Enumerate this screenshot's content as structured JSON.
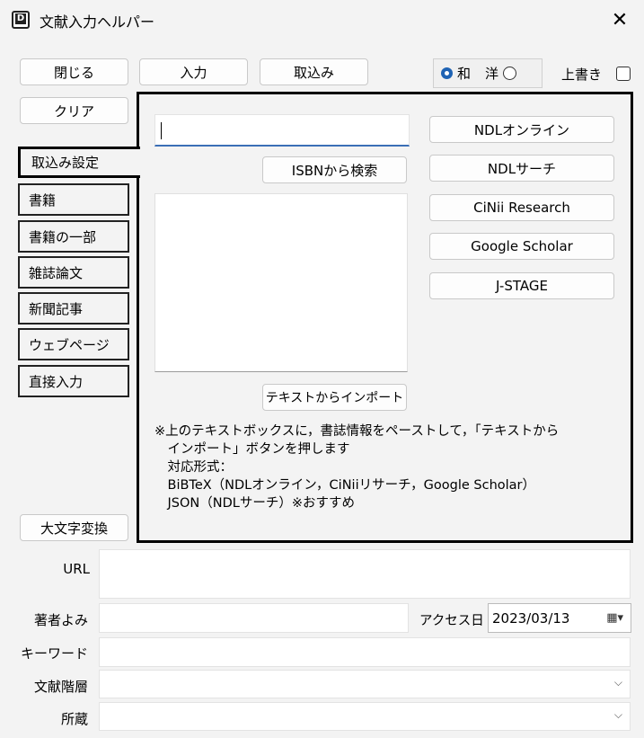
{
  "window": {
    "title": "文献入力ヘルパー",
    "app_icon_letter": "D",
    "close_glyph": "✕"
  },
  "top_buttons": {
    "close": "閉じる",
    "input": "入力",
    "import": "取込み",
    "clear": "クリア"
  },
  "language_radio": {
    "option_ja": "和",
    "option_en": "洋",
    "selected": "和"
  },
  "overwrite": {
    "label": "上書き",
    "checked": false
  },
  "tabs": {
    "active": "取込み設定",
    "items": [
      "書籍",
      "書籍の一部",
      "雑誌論文",
      "新聞記事",
      "ウェブページ",
      "直接入力"
    ]
  },
  "import_panel": {
    "isbn_value": "",
    "isbn_search_button": "ISBNから検索",
    "text_import_button": "テキストからインポート",
    "sources": [
      "NDLオンライン",
      "NDLサーチ",
      "CiNii Research",
      "Google Scholar",
      "J-STAGE"
    ],
    "note_lines": [
      "※上のテキストボックスに，書誌情報をペーストして，「テキストから",
      "　インポート」ボタンを押します",
      "　対応形式：",
      "　BiBTeX（NDLオンライン，CiNiiリサーチ，Google Scholar）",
      "　JSON（NDLサーチ）※おすすめ"
    ]
  },
  "uppercase_button": "大文字変換",
  "fields": {
    "url_label": "URL",
    "url_value": "",
    "author_reading_label": "著者よみ",
    "author_reading_value": "",
    "access_date_label": "アクセス日",
    "access_date_value": "2023/03/13",
    "keyword_label": "キーワード",
    "keyword_value": "",
    "hierarchy_label": "文献階層",
    "hierarchy_value": "",
    "holding_label": "所蔵",
    "holding_value": ""
  },
  "icons": {
    "calendar": "calendar-icon",
    "dropdown": "chevron-down-icon"
  }
}
